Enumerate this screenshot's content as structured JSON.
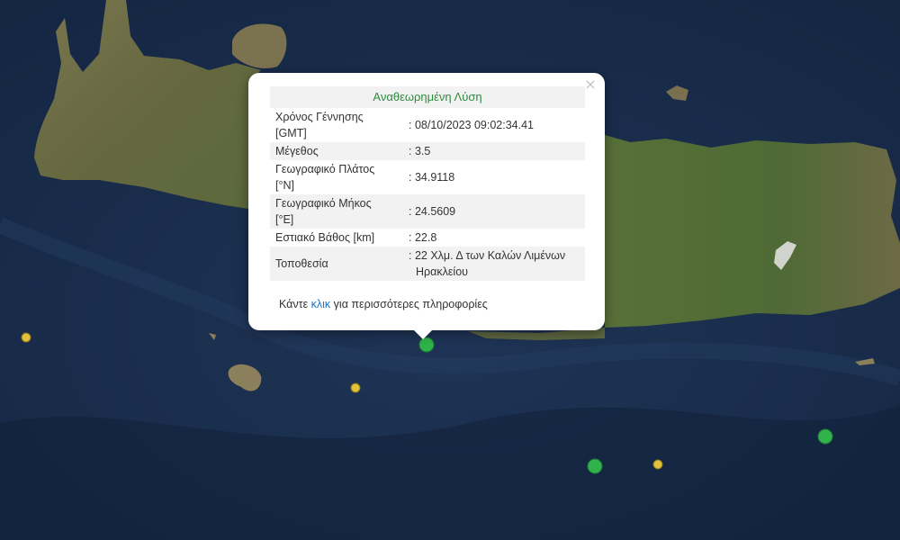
{
  "map": {
    "colors": {
      "sea": "#1b2f4f",
      "sea_dark": "#132540",
      "land": "#6b6e46",
      "land_green": "#4d6a3a",
      "land_light": "#8a7f5c",
      "snow": "#e8e8e8"
    },
    "markers": [
      {
        "name": "quake-marker-selected",
        "color": "#2fb34a",
        "size": "large"
      },
      {
        "name": "quake-marker-yellow-1",
        "color": "#e1c03a",
        "size": "small"
      },
      {
        "name": "quake-marker-yellow-2",
        "color": "#e1c03a",
        "size": "small"
      },
      {
        "name": "quake-marker-yellow-3",
        "color": "#e1c03a",
        "size": "small"
      },
      {
        "name": "quake-marker-green-2",
        "color": "#2fb34a",
        "size": "large"
      },
      {
        "name": "quake-marker-green-3",
        "color": "#2fb34a",
        "size": "large"
      }
    ]
  },
  "popup": {
    "title": "Αναθεωρημένη Λύση",
    "close_icon": "×",
    "rows": [
      {
        "label_lines": [
          "Χρόνος Γέννησης",
          "[GMT]"
        ],
        "value_lines": [
          ": 08/10/2023 09:02:34.41"
        ]
      },
      {
        "label_lines": [
          "Μέγεθος"
        ],
        "value_lines": [
          ": 3.5"
        ]
      },
      {
        "label_lines": [
          "Γεωγραφικό Πλάτος",
          "[°N]"
        ],
        "value_lines": [
          ": 34.9118"
        ]
      },
      {
        "label_lines": [
          "Γεωγραφικό Μήκος",
          "[°E]"
        ],
        "value_lines": [
          ": 24.5609"
        ]
      },
      {
        "label_lines": [
          "Εστιακό Βάθος [km]"
        ],
        "value_lines": [
          ": 22.8"
        ]
      },
      {
        "label_lines": [
          "Τοποθεσία"
        ],
        "value_lines": [
          ": 22 Χλμ. Δ των Καλών Λιμένων",
          "Ηρακλείου"
        ]
      }
    ],
    "footer": {
      "before": "Κάντε ",
      "link": "κλικ",
      "after": " για περισσότερες πληροφορίες"
    }
  }
}
